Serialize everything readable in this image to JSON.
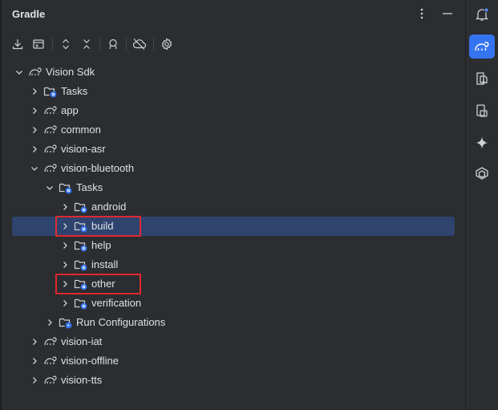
{
  "panel": {
    "title": "Gradle",
    "actions": [
      {
        "icon": "more-vertical-icon"
      },
      {
        "icon": "minimize-icon"
      }
    ]
  },
  "toolbar": {
    "buttons": [
      {
        "icon": "download-sources-icon"
      },
      {
        "icon": "run-task-icon"
      },
      {
        "icon": "expand-all-icon"
      },
      {
        "icon": "collapse-all-icon"
      },
      {
        "icon": "analyze-dependencies-icon"
      },
      {
        "icon": "toggle-offline-icon"
      },
      {
        "icon": "settings-icon"
      }
    ]
  },
  "tree": {
    "rows": [
      {
        "label": "Vision Sdk",
        "icon": "gradle-elephant-icon",
        "expanded": true,
        "depth": 0
      },
      {
        "label": "Tasks",
        "icon": "task-folder-icon",
        "expanded": false,
        "depth": 1
      },
      {
        "label": "app",
        "icon": "gradle-elephant-icon",
        "expanded": false,
        "depth": 1
      },
      {
        "label": "common",
        "icon": "gradle-elephant-icon",
        "expanded": false,
        "depth": 1
      },
      {
        "label": "vision-asr",
        "icon": "gradle-elephant-icon",
        "expanded": false,
        "depth": 1
      },
      {
        "label": "vision-bluetooth",
        "icon": "gradle-elephant-icon",
        "expanded": true,
        "depth": 1
      },
      {
        "label": "Tasks",
        "icon": "task-folder-icon",
        "expanded": true,
        "depth": 2
      },
      {
        "label": "android",
        "icon": "task-folder-icon",
        "expanded": false,
        "depth": 3
      },
      {
        "label": "build",
        "icon": "task-folder-icon",
        "expanded": false,
        "depth": 3,
        "selected": true,
        "highlighted": true
      },
      {
        "label": "help",
        "icon": "task-folder-icon",
        "expanded": false,
        "depth": 3
      },
      {
        "label": "install",
        "icon": "task-folder-icon",
        "expanded": false,
        "depth": 3
      },
      {
        "label": "other",
        "icon": "task-folder-icon",
        "expanded": false,
        "depth": 3,
        "highlighted": true
      },
      {
        "label": "verification",
        "icon": "task-folder-icon",
        "expanded": false,
        "depth": 3
      },
      {
        "label": "Run Configurations",
        "icon": "run-config-folder-icon",
        "expanded": false,
        "depth": 2
      },
      {
        "label": "vision-iat",
        "icon": "gradle-elephant-icon",
        "expanded": false,
        "depth": 1
      },
      {
        "label": "vision-offline",
        "icon": "gradle-elephant-icon",
        "expanded": false,
        "depth": 1
      },
      {
        "label": "vision-tts",
        "icon": "gradle-elephant-icon",
        "expanded": false,
        "depth": 1
      }
    ]
  },
  "rightbar": {
    "buttons": [
      {
        "icon": "notifications-icon",
        "active": false,
        "badge": true
      },
      {
        "icon": "gradle-icon",
        "active": true
      },
      {
        "icon": "device-manager-icon",
        "active": false
      },
      {
        "icon": "running-devices-icon",
        "active": false
      },
      {
        "icon": "gemini-icon",
        "active": false
      },
      {
        "icon": "app-quality-insights-icon",
        "active": false
      }
    ]
  },
  "colors": {
    "background": "#2b2d30",
    "selection": "#2e436e",
    "highlight_box": "#e0292e",
    "accent": "#3574f0",
    "badge": "#548af7"
  }
}
